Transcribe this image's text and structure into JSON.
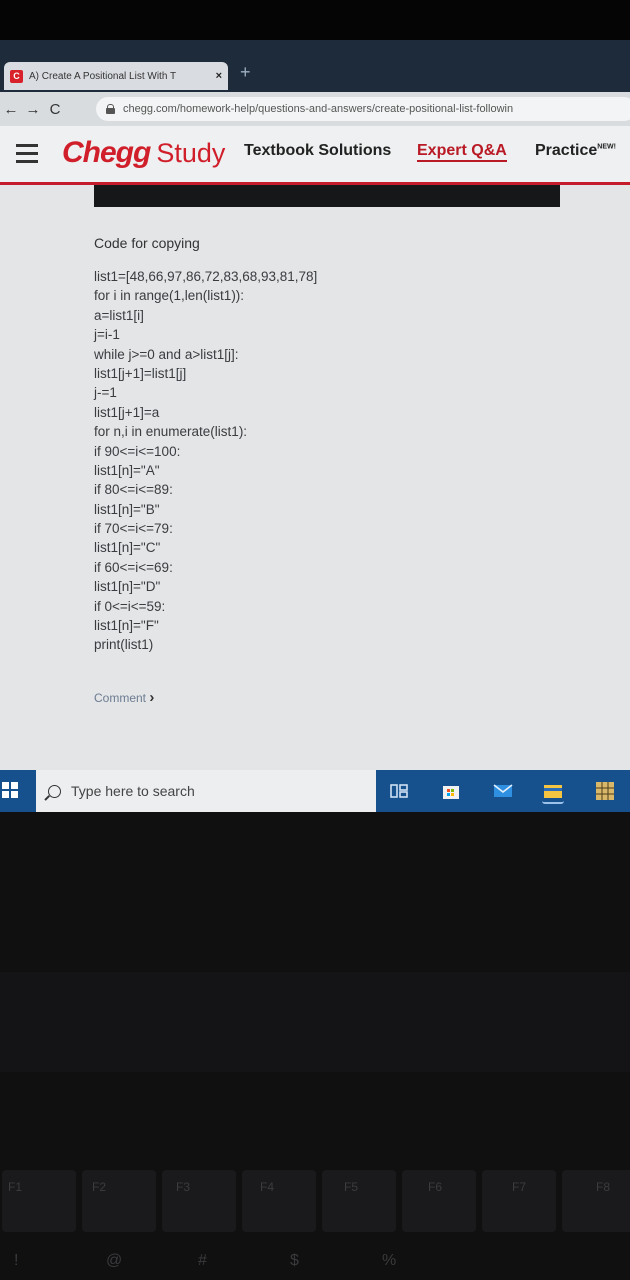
{
  "browser": {
    "tab_title": "A) Create A Positional List With T",
    "tab_close": "×",
    "new_tab": "+",
    "url": "chegg.com/homework-help/questions-and-answers/create-positional-list-followin"
  },
  "header": {
    "logo_main": "Chegg",
    "logo_sub": "Study",
    "nav": [
      {
        "label": "Textbook Solutions"
      },
      {
        "label": "Expert Q&A"
      },
      {
        "label": "Practice",
        "badge": "NEW!"
      }
    ]
  },
  "answer": {
    "heading": "Code for copying",
    "code_lines": [
      "list1=[48,66,97,86,72,83,68,93,81,78]",
      "for i in range(1,len(list1)):",
      "a=list1[i]",
      "j=i-1",
      "while j>=0 and a>list1[j]:",
      "list1[j+1]=list1[j]",
      "j-=1",
      "list1[j+1]=a",
      "for n,i in enumerate(list1):",
      "if 90<=i<=100:",
      "list1[n]=\"A\"",
      "if 80<=i<=89:",
      "list1[n]=\"B\"",
      "if 70<=i<=79:",
      "list1[n]=\"C\"",
      "if 60<=i<=69:",
      "list1[n]=\"D\"",
      "if 0<=i<=59:",
      "list1[n]=\"F\"",
      "print(list1)"
    ],
    "comment_link": "Comment",
    "comment_chevron": "›"
  },
  "taskbar": {
    "search_placeholder": "Type here to search"
  },
  "keyboard": {
    "fkeys": [
      "F1",
      "F2",
      "F3",
      "F4",
      "F5",
      "F6",
      "F7",
      "F8"
    ],
    "symbols": [
      "!",
      "@",
      "#",
      "$",
      "%"
    ]
  }
}
